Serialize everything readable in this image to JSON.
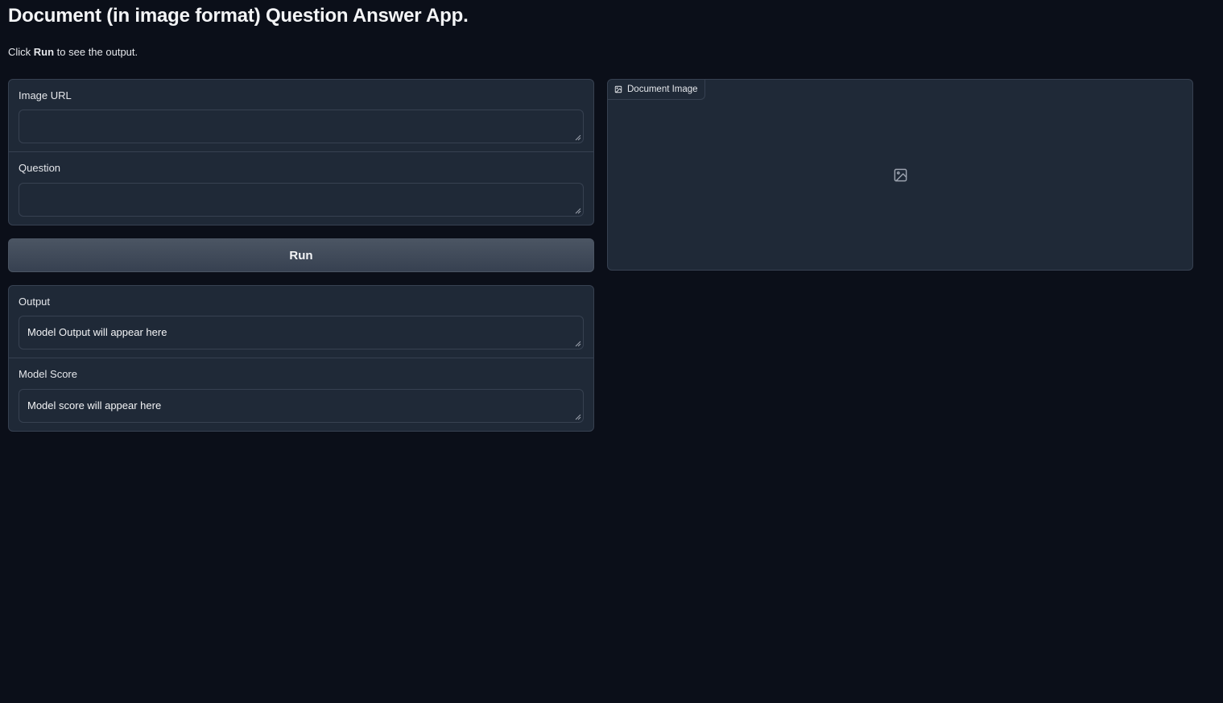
{
  "header": {
    "title": "Document (in image format) Question Answer App.",
    "desc_prefix": "Click ",
    "desc_bold": "Run",
    "desc_suffix": " to see the output."
  },
  "inputs": {
    "image_url": {
      "label": "Image URL",
      "value": "",
      "placeholder": ""
    },
    "question": {
      "label": "Question",
      "value": "",
      "placeholder": ""
    }
  },
  "run_button": {
    "label": "Run"
  },
  "outputs": {
    "output": {
      "label": "Output",
      "value": "Model Output will appear here"
    },
    "model_score": {
      "label": "Model Score",
      "value": "Model score will appear here"
    }
  },
  "document_image": {
    "label": "Document Image",
    "icon": "image-icon"
  },
  "colors": {
    "background": "#0b0f19",
    "panel": "#1f2937",
    "border": "#374151",
    "button": "#4b5563"
  }
}
